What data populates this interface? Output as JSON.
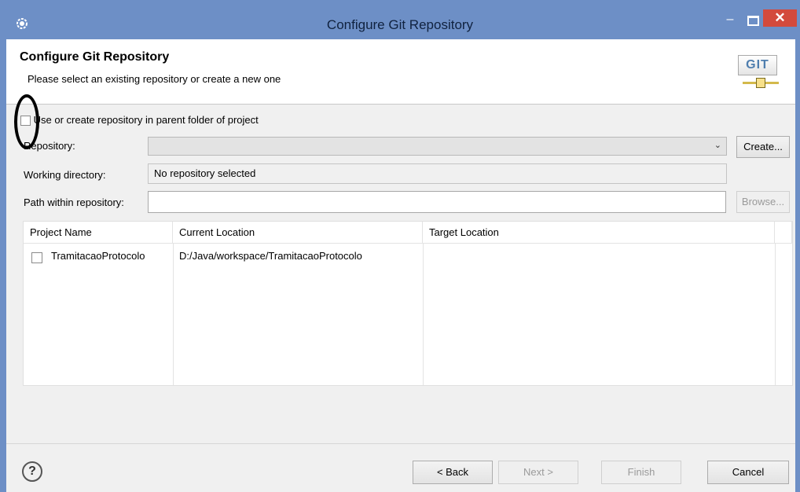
{
  "window": {
    "title": "Configure Git Repository"
  },
  "header": {
    "title": "Configure Git Repository",
    "subtitle": "Please select an existing repository or create a new one",
    "logo_text": "GIT"
  },
  "form": {
    "use_parent_label": "Use or create repository in parent folder of project",
    "use_parent_checked": false,
    "repository_label": "Repository:",
    "repository_value": "",
    "create_button": "Create...",
    "working_dir_label": "Working directory:",
    "working_dir_value": "No repository selected",
    "path_label": "Path within repository:",
    "path_value": "",
    "browse_button": "Browse..."
  },
  "table": {
    "columns": [
      "Project Name",
      "Current Location",
      "Target Location"
    ],
    "rows": [
      {
        "checked": false,
        "project": "TramitacaoProtocolo",
        "current": "D:/Java/workspace/TramitacaoProtocolo",
        "target": ""
      }
    ]
  },
  "buttons": {
    "back": "< Back",
    "next": "Next >",
    "finish": "Finish",
    "cancel": "Cancel"
  }
}
